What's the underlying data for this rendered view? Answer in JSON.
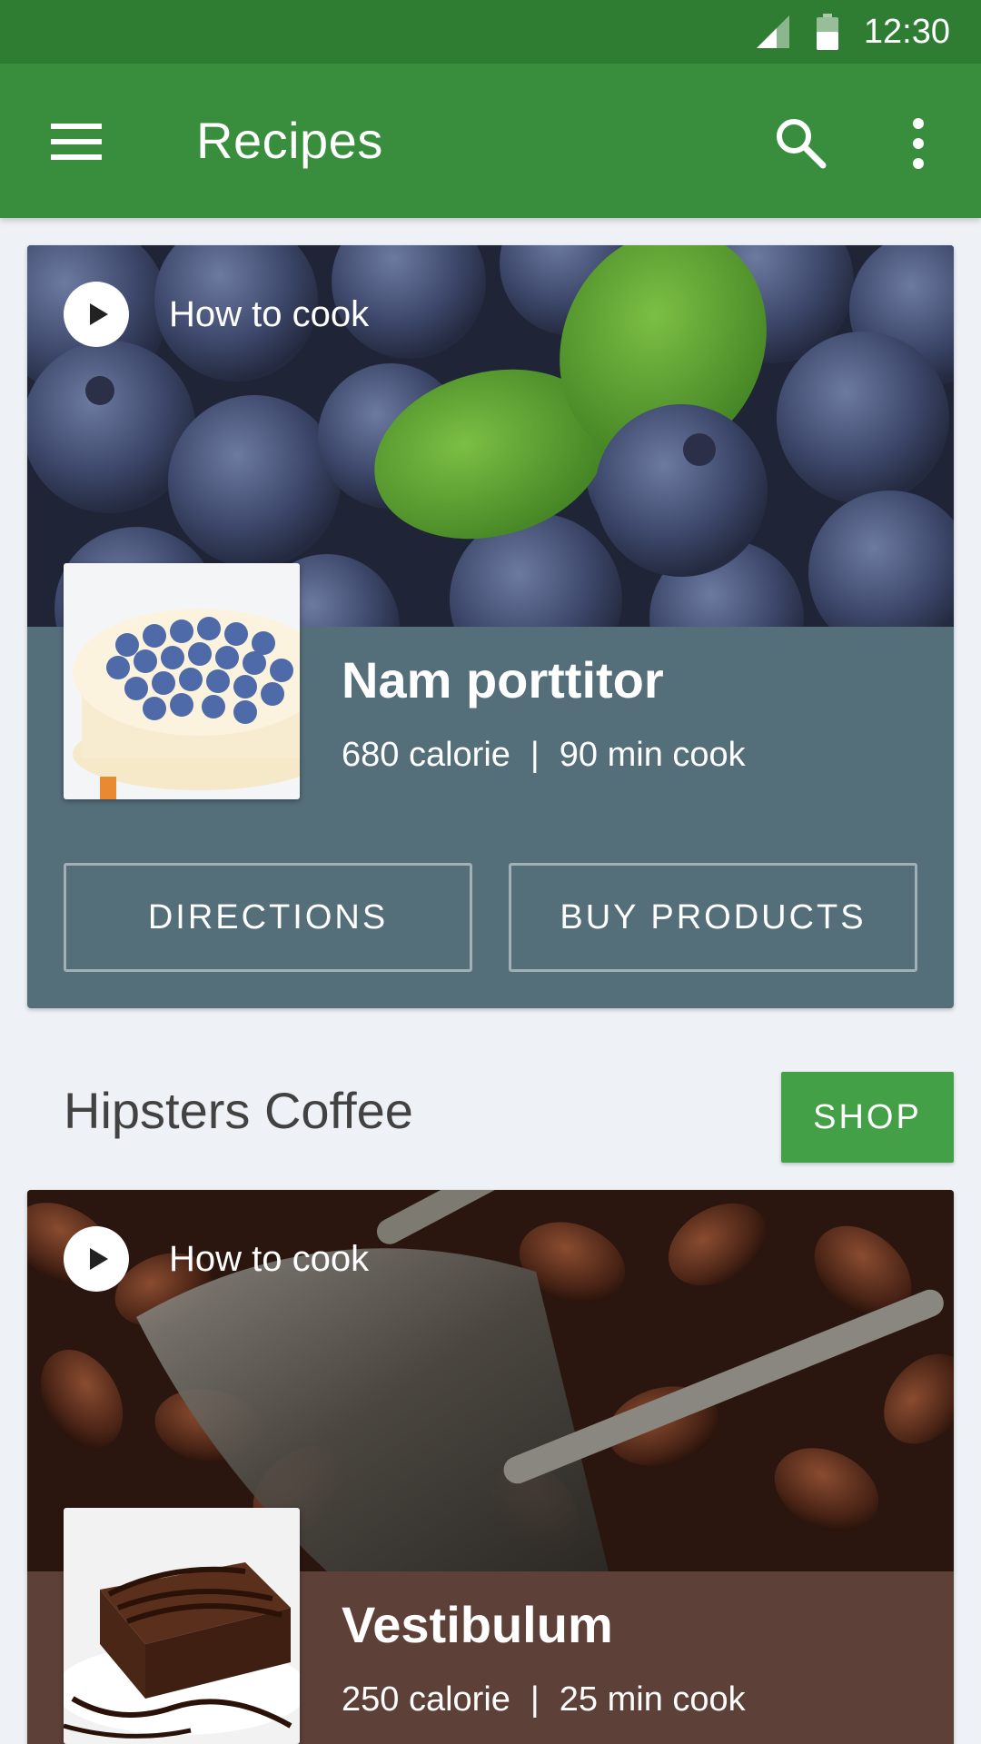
{
  "status_bar": {
    "time": "12:30"
  },
  "app_bar": {
    "title": "Recipes"
  },
  "cards": [
    {
      "how_to_label": "How to cook",
      "title": "Nam porttitor",
      "calories": "680 calorie",
      "separator": "|",
      "cook_time": "90 min cook",
      "buttons": {
        "directions": "DIRECTIONS",
        "buy": "BUY PRODUCTS"
      }
    },
    {
      "how_to_label": "How to cook",
      "title": "Vestibulum",
      "calories": "250 calorie",
      "separator": "|",
      "cook_time": "25 min cook"
    }
  ],
  "section": {
    "title": "Hipsters Coffee",
    "shop_label": "SHOP"
  },
  "colors": {
    "status_bar": "#2e7d32",
    "app_bar": "#388e3c",
    "card1_panel": "#546e7a",
    "card2_panel": "#5d4037",
    "shop_button": "#43a047"
  }
}
